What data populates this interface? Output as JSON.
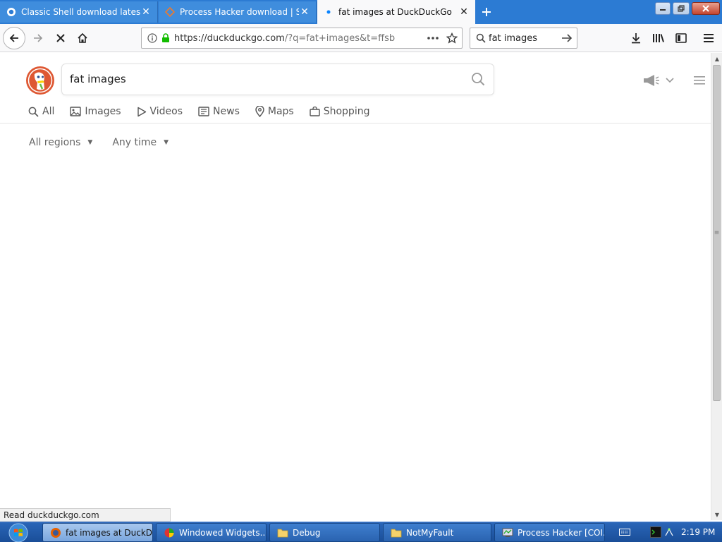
{
  "browser": {
    "tabs": [
      {
        "title": "Classic Shell download latest ve",
        "active": false
      },
      {
        "title": "Process Hacker download | Sou",
        "active": false
      },
      {
        "title": "fat images at DuckDuckGo",
        "active": true
      }
    ],
    "new_tab_icon": "plus-icon",
    "url": {
      "host": "https://duckduckgo.com",
      "path": "/?q=fat+images&t=ffsb"
    },
    "search_bar_text": "fat images",
    "status_text": "Read duckduckgo.com"
  },
  "ddg": {
    "query": "fat images",
    "tabs": [
      {
        "label": "All",
        "icon": "search-icon"
      },
      {
        "label": "Images",
        "icon": "image-icon"
      },
      {
        "label": "Videos",
        "icon": "play-icon"
      },
      {
        "label": "News",
        "icon": "newspaper-icon"
      },
      {
        "label": "Maps",
        "icon": "map-pin-icon"
      },
      {
        "label": "Shopping",
        "icon": "shopping-bag-icon"
      }
    ],
    "filters": [
      {
        "label": "All regions"
      },
      {
        "label": "Any time"
      }
    ]
  },
  "taskbar": {
    "items": [
      {
        "label": "fat images at DuckD...",
        "active": true
      },
      {
        "label": "Windowed Widgets...",
        "active": false
      },
      {
        "label": "Debug",
        "active": false
      },
      {
        "label": "NotMyFault",
        "active": false
      },
      {
        "label": "Process Hacker [COI...",
        "active": false
      }
    ],
    "clock": "2:19 PM"
  },
  "colors": {
    "tabstrip": "#2c7bd3",
    "ddg_orange": "#de5833",
    "taskbar": "#1f5aa8"
  }
}
